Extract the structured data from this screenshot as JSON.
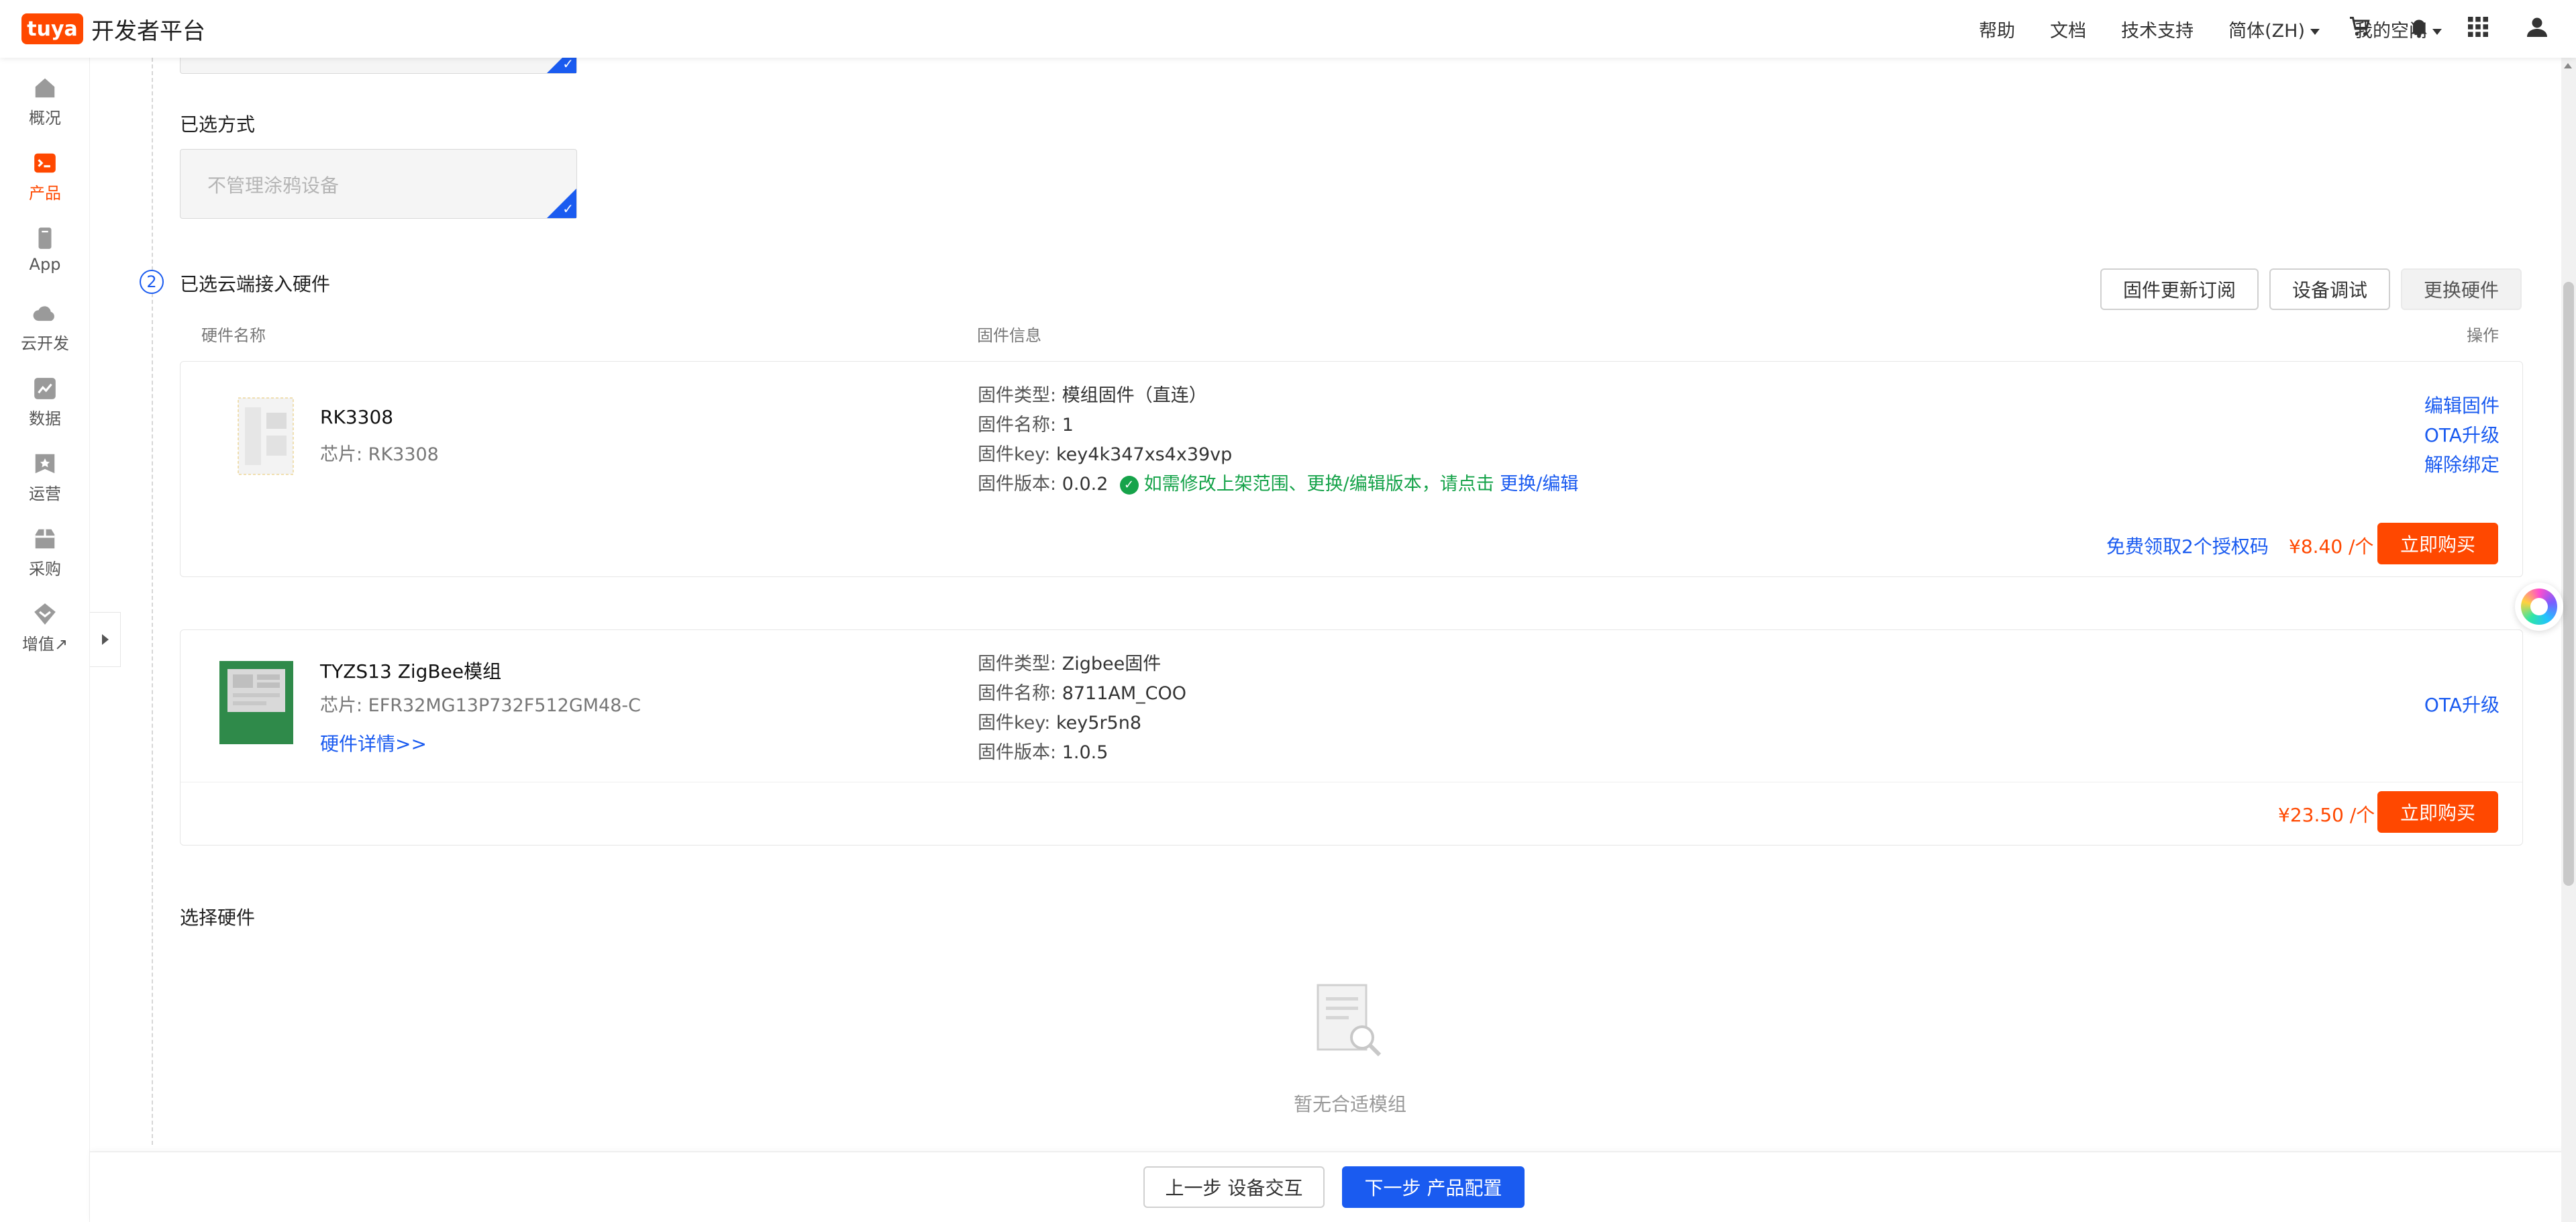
{
  "header": {
    "logo_text": "tuya",
    "brand": "开发者平台",
    "links": [
      "帮助",
      "文档",
      "技术支持"
    ],
    "lang": "简体(ZH)",
    "space": "我的空间"
  },
  "sidebar": {
    "items": [
      {
        "label": "概况",
        "icon": "home-icon"
      },
      {
        "label": "产品",
        "icon": "product-icon"
      },
      {
        "label": "App",
        "icon": "phone-icon"
      },
      {
        "label": "云开发",
        "icon": "cloud-icon"
      },
      {
        "label": "数据",
        "icon": "chart-icon"
      },
      {
        "label": "运营",
        "icon": "operation-icon"
      },
      {
        "label": "采购",
        "icon": "purchase-icon"
      },
      {
        "label": "增值",
        "icon": "value-added-icon"
      }
    ],
    "external_mark": "↗"
  },
  "form": {
    "selected_method_label": "已选方式",
    "selected_method_value": "不管理涂鸦设备",
    "step_number": "2",
    "section_title": "已选云端接入硬件"
  },
  "actions": {
    "firmware_subscribe": "固件更新订阅",
    "device_debug": "设备调试",
    "replace_hardware": "更换硬件"
  },
  "table": {
    "col_hardware": "硬件名称",
    "col_firmware": "固件信息",
    "col_ops": "操作"
  },
  "hardware": [
    {
      "name": "RK3308",
      "chip": "芯片: RK3308",
      "fw_type_key": "固件类型:",
      "fw_type": "模组固件（直连）",
      "fw_name_key": "固件名称:",
      "fw_name": "1",
      "fw_key_key": "固件key:",
      "fw_key": "key4k347xs4x39vp",
      "fw_ver_key": "固件版本:",
      "fw_ver": "0.0.2",
      "notice": "如需修改上架范围、更换/编辑版本，请点击",
      "notice_link": "更换/编辑",
      "ops": [
        "编辑固件",
        "OTA升级",
        "解除绑定"
      ],
      "free_license": "免费领取2个授权码",
      "price": "¥8.40 /个",
      "buy": "立即购买"
    },
    {
      "name": "TYZS13 ZigBee模组",
      "chip": "芯片: EFR32MG13P732F512GM48-C",
      "details_link": "硬件详情>>",
      "fw_type_key": "固件类型:",
      "fw_type": "Zigbee固件",
      "fw_name_key": "固件名称:",
      "fw_name": "8711AM_COO",
      "fw_key_key": "固件key:",
      "fw_key": "key5r5n8",
      "fw_ver_key": "固件版本:",
      "fw_ver": "1.0.5",
      "ops": [
        "OTA升级"
      ],
      "price": "¥23.50 /个",
      "buy": "立即购买"
    }
  ],
  "select_hardware": {
    "title": "选择硬件",
    "empty_text": "暂无合适模组"
  },
  "footer": {
    "prev": "上一步 设备交互",
    "next": "下一步 产品配置"
  },
  "colors": {
    "brand_orange": "#ff4800",
    "primary_blue": "#1a5bf0",
    "success_green": "#16a34a"
  }
}
